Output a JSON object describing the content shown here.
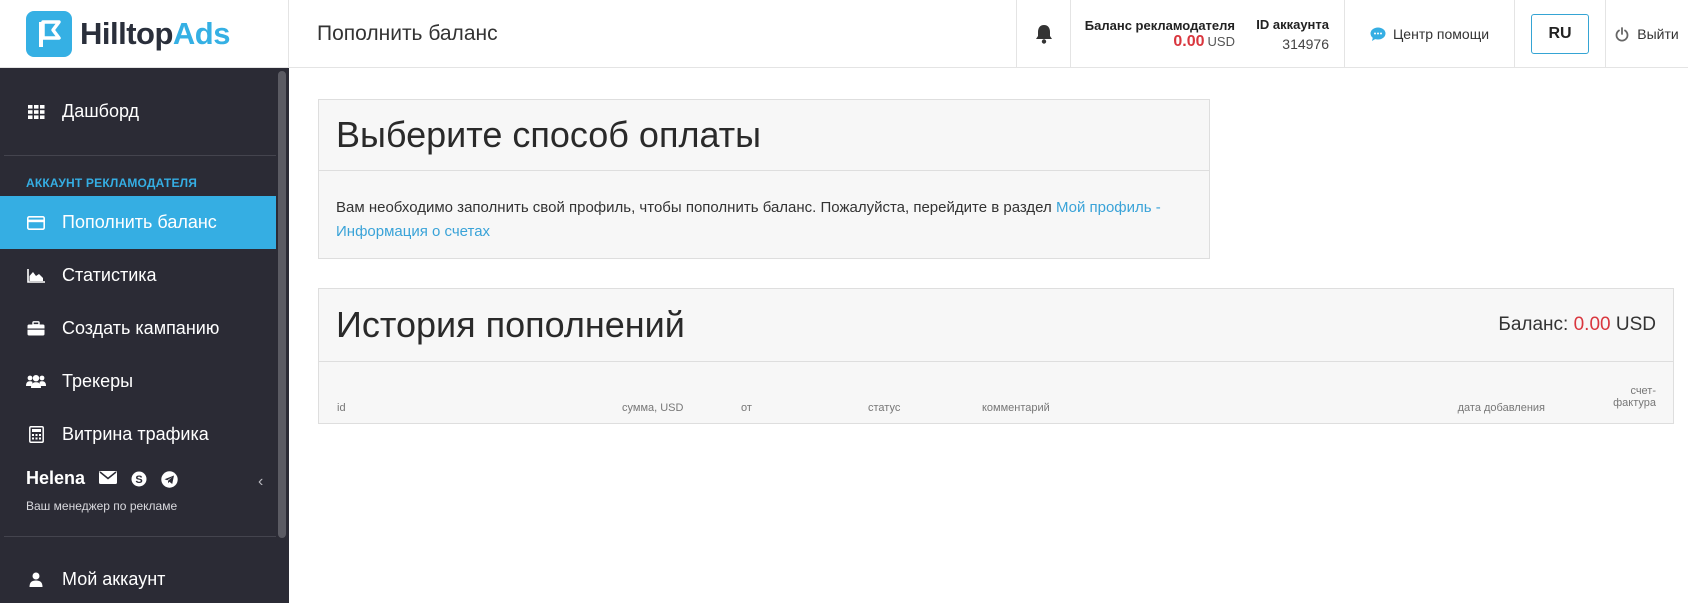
{
  "brand": {
    "name_part1": "Hilltop",
    "name_part2": "Ads",
    "color": "#35b0e4"
  },
  "header": {
    "title": "Пополнить баланс",
    "bell_icon": "bell-icon",
    "balance_label": "Баланс рекламодателя",
    "balance_value": "0.00",
    "balance_unit": "USD",
    "account_label": "ID аккаунта",
    "account_id": "314976",
    "help_label": "Центр помощи",
    "lang": "RU",
    "logout_label": "Выйти"
  },
  "sidebar": {
    "dashboard": "Дашборд",
    "section": "АККАУНТ РЕКЛАМОДАТЕЛЯ",
    "items": [
      {
        "label": "Пополнить баланс",
        "icon": "credit-card-icon",
        "active": true
      },
      {
        "label": "Статистика",
        "icon": "area-chart-icon"
      },
      {
        "label": "Создать кампанию",
        "icon": "briefcase-icon"
      },
      {
        "label": "Трекеры",
        "icon": "users-icon"
      },
      {
        "label": "Витрина трафика",
        "icon": "calculator-icon"
      }
    ],
    "manager_name": "Helena",
    "manager_sub": "Ваш менеджер по рекламе",
    "my_account": "Мой аккаунт"
  },
  "payment_panel": {
    "title": "Выберите способ оплаты",
    "text": "Вам необходимо заполнить свой профиль, чтобы пополнить баланс. Пожалуйста, перейдите в раздел ",
    "link": "Мой профиль - Информация о счетах"
  },
  "history_panel": {
    "title": "История пополнений",
    "balance_label": "Баланс:",
    "balance_value": "0.00",
    "balance_unit": "USD",
    "columns": [
      "id",
      "сумма, USD",
      "от",
      "статус",
      "комментарий",
      "дата добавления",
      "счет-",
      "фактура"
    ]
  },
  "colors": {
    "accent": "#35aee3",
    "sidebar_bg": "#2b2b35",
    "balance_red": "#d9363e"
  }
}
